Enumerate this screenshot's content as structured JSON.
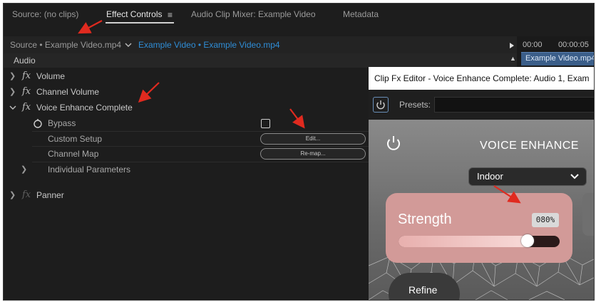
{
  "tabs": [
    {
      "label": "Source: (no clips)",
      "active": false
    },
    {
      "label": "Effect Controls",
      "active": true
    },
    {
      "label": "Audio Clip Mixer: Example Video",
      "active": false
    },
    {
      "label": "Metadata",
      "active": false
    }
  ],
  "source_bar": {
    "master_clip": "Source • Example Video.mp4",
    "sequence_clip": "Example Video • Example Video.mp4"
  },
  "timeline": {
    "timecode_1": "00:00",
    "timecode_2": "00:00:05",
    "clip_label": "Example Video.mp4"
  },
  "section_header": "Audio",
  "effects": {
    "volume": "Volume",
    "channel_volume": "Channel Volume",
    "voice_enhance": "Voice Enhance Complete",
    "bypass": "Bypass",
    "custom_setup": "Custom Setup",
    "channel_map": "Channel Map",
    "individual_parameters": "Individual Parameters",
    "panner": "Panner",
    "fx_symbol": "fx",
    "edit_button": "Edit...",
    "remap_button": "Re-map..."
  },
  "editor": {
    "title": "Clip Fx Editor - Voice Enhance Complete: Audio 1, Exam",
    "presets_label": "Presets:",
    "plugin_title": "VOICE ENHANCE",
    "mode": "Indoor",
    "strength_label": "Strength",
    "strength_value_text": "080%",
    "strength_value": 0.8,
    "refine_label": "Refine"
  },
  "colors": {
    "accent_blue": "#2f8dd6",
    "annotation_red": "#e02a1f",
    "strength_card": "#d29a98"
  }
}
